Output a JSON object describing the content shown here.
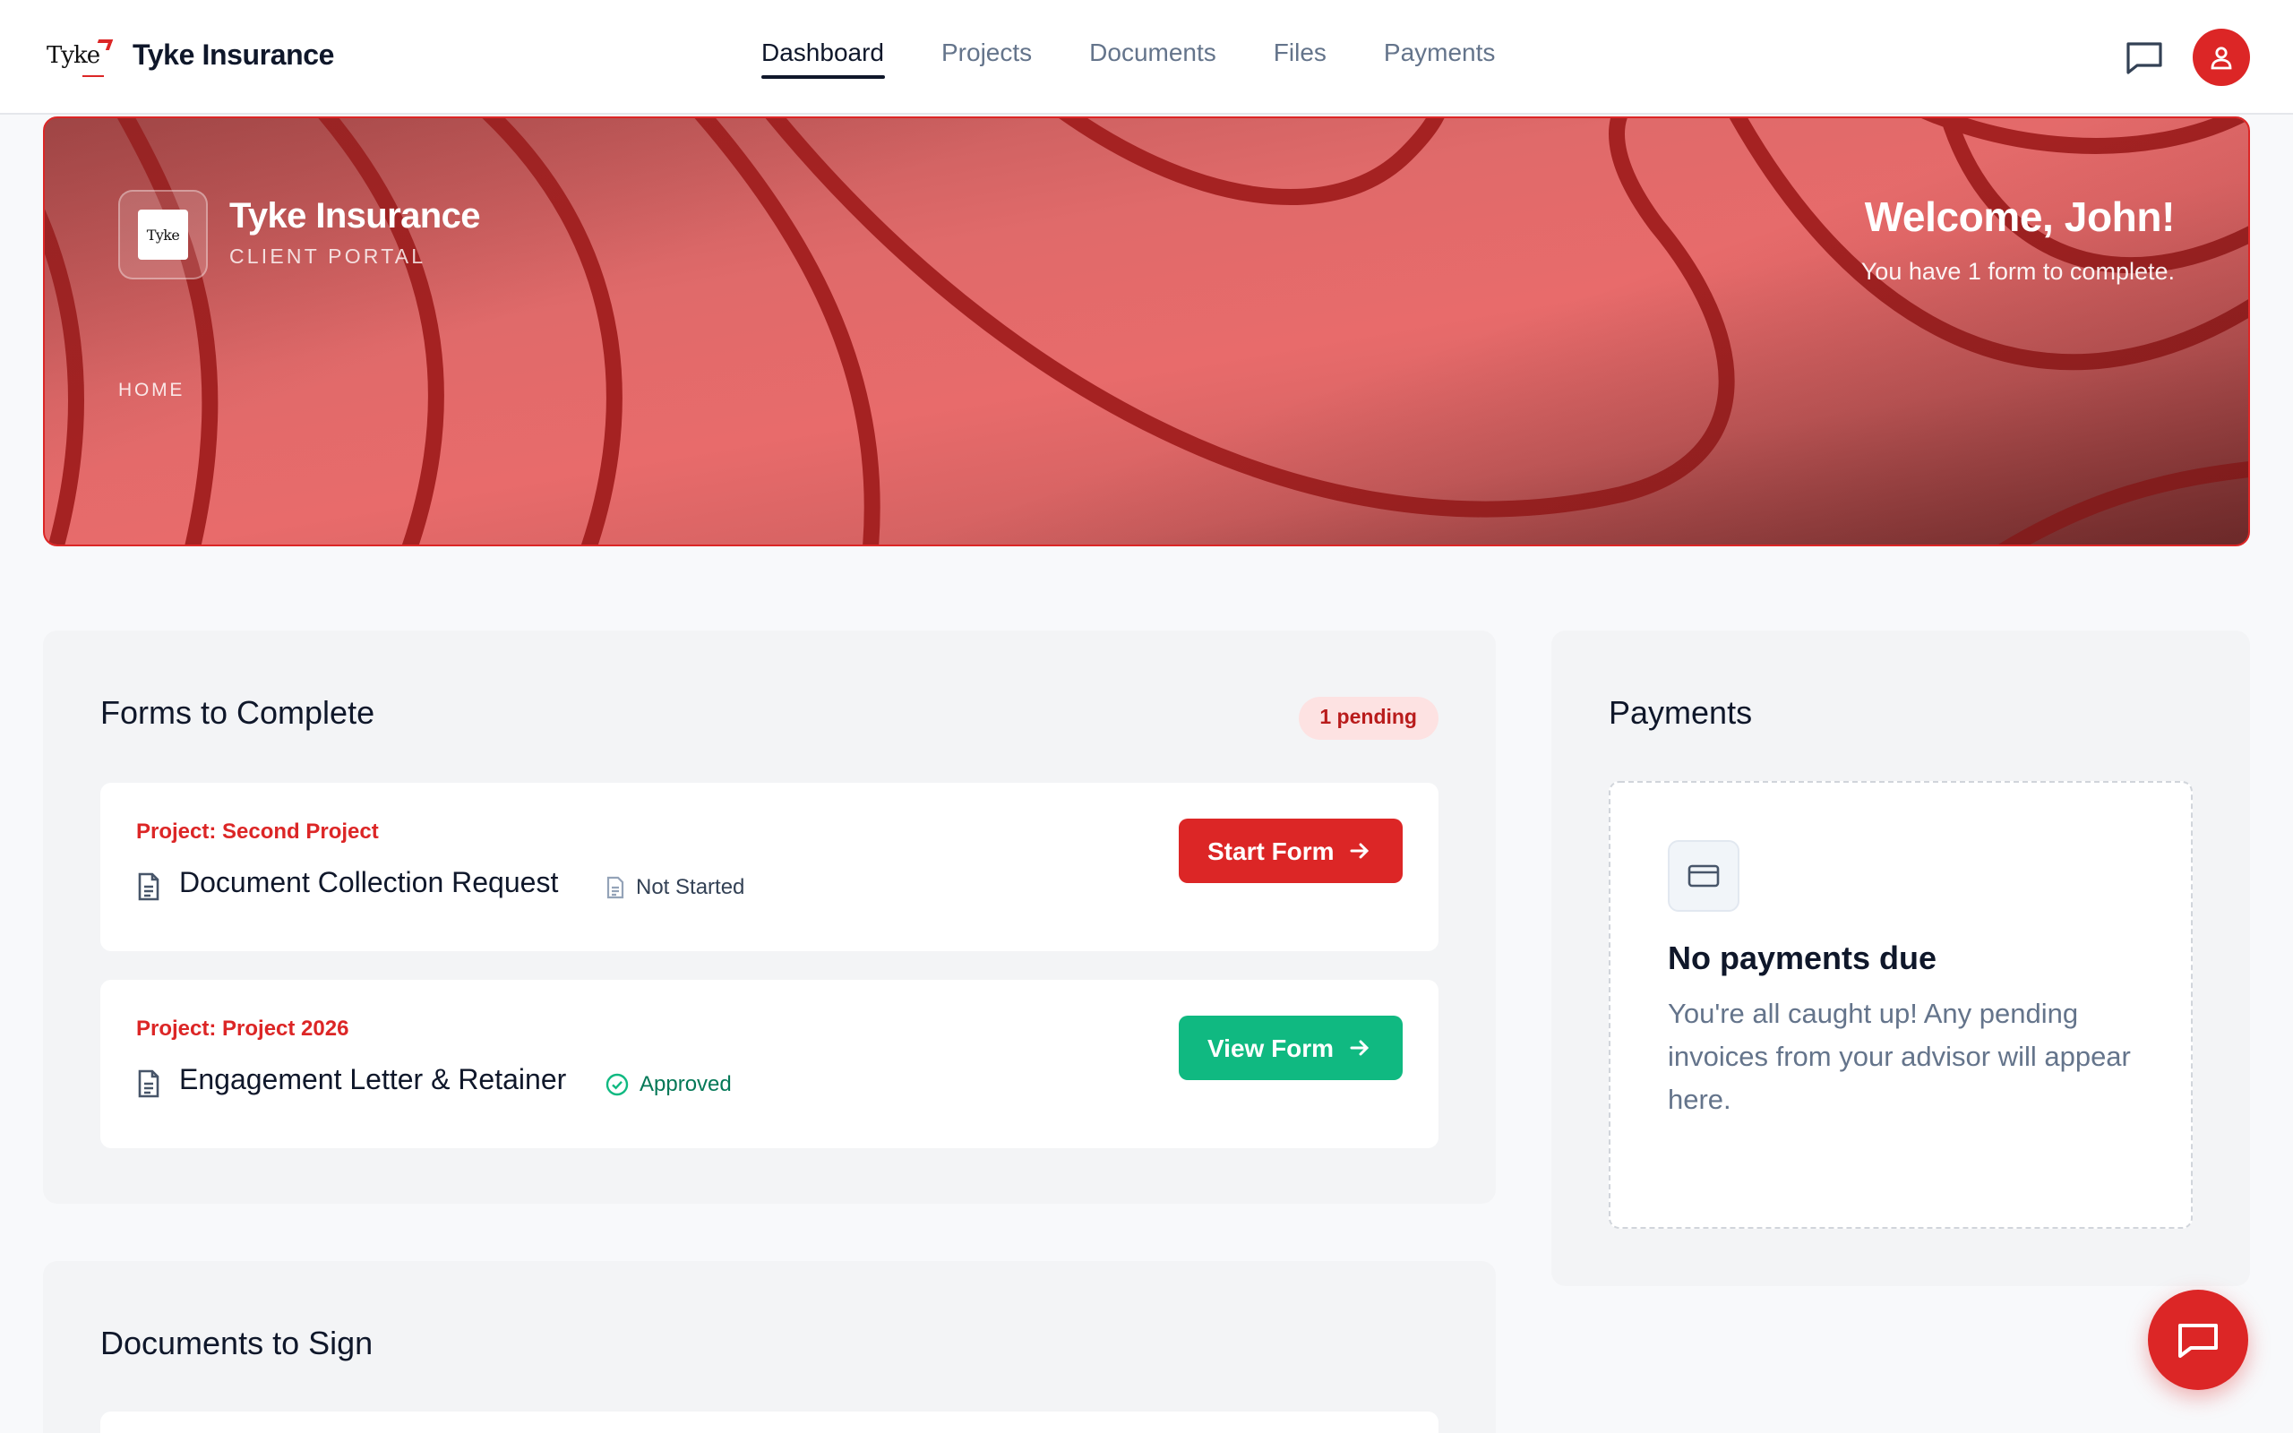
{
  "app": {
    "brand_name": "Tyke Insurance",
    "logo_text": "Tyke"
  },
  "nav": {
    "items": [
      {
        "label": "Dashboard",
        "active": true
      },
      {
        "label": "Projects",
        "active": false
      },
      {
        "label": "Documents",
        "active": false
      },
      {
        "label": "Files",
        "active": false
      },
      {
        "label": "Payments",
        "active": false
      }
    ]
  },
  "header_icons": {
    "messages": "message-square-icon",
    "profile": "user-icon"
  },
  "hero": {
    "title": "Tyke Insurance",
    "subtitle": "CLIENT PORTAL",
    "breadcrumb": "HOME",
    "welcome": "Welcome, John!",
    "welcome_sub": "You have 1 form to complete."
  },
  "forms": {
    "title": "Forms to Complete",
    "badge": "1 pending",
    "items": [
      {
        "project": "Project: Second Project",
        "name": "Document Collection Request",
        "status": "Not Started",
        "status_icon": "file-icon",
        "button": "Start Form",
        "button_color": "#dc2626"
      },
      {
        "project": "Project: Project 2026",
        "name": "Engagement Letter & Retainer",
        "status": "Approved",
        "status_icon": "check-circle-icon",
        "button": "View Form",
        "button_color": "#10b981"
      }
    ]
  },
  "payments": {
    "title": "Payments",
    "empty_title": "No payments due",
    "empty_text": "You're all caught up! Any pending invoices from your advisor will appear here.",
    "empty_icon": "credit-card-icon"
  },
  "documents": {
    "title": "Documents to Sign"
  },
  "colors": {
    "accent": "#dc2626",
    "success": "#10b981",
    "text": "#0f172a",
    "muted": "#64748b"
  }
}
